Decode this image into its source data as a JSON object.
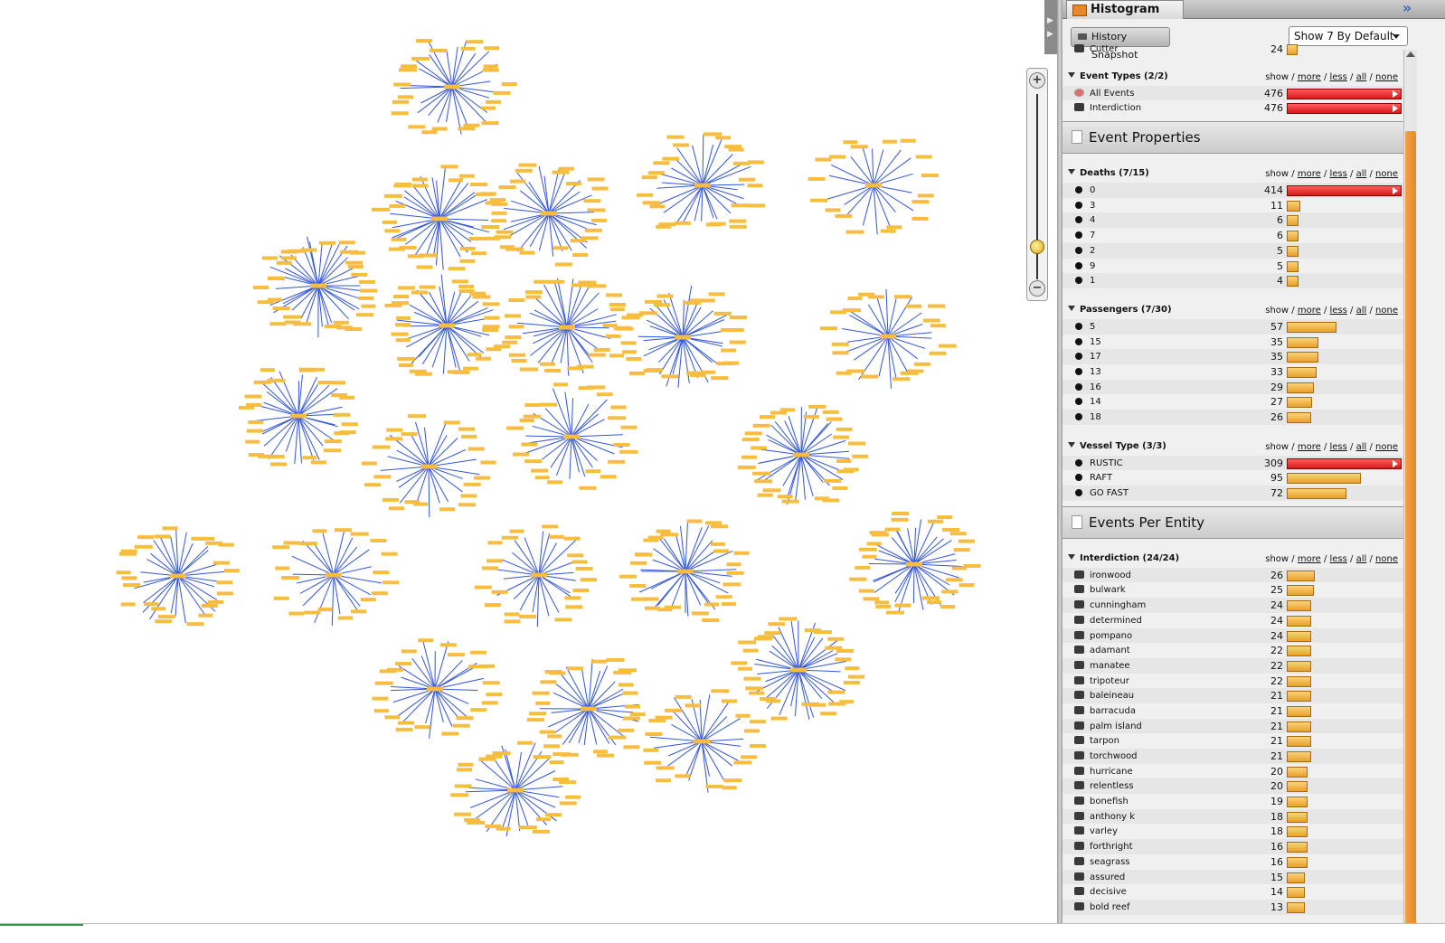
{
  "panel": {
    "title": "Histogram",
    "snapshot_label": "History Snapshot",
    "show_select": "Show 7 By Default"
  },
  "link_words": {
    "show": "show",
    "more": "more",
    "less": "less",
    "all": "all",
    "none": "none",
    "sep": "/"
  },
  "top_partial": {
    "label": "Cutter",
    "count": 24,
    "frac": 0.05
  },
  "event_types": {
    "title": "Event Types (2/2)",
    "rows": [
      {
        "label": "All Events",
        "count": 476,
        "frac": 1.0,
        "red": true,
        "icon": "globe-icon"
      },
      {
        "label": "Interdiction",
        "count": 476,
        "frac": 1.0,
        "red": true,
        "icon": "boat-icon"
      }
    ]
  },
  "sections": [
    {
      "title": "Event Properties",
      "groups": [
        {
          "title": "Deaths (7/15)",
          "rows": [
            {
              "label": "0",
              "count": 414,
              "frac": 1.0,
              "red": true
            },
            {
              "label": "3",
              "count": 11,
              "frac": 0.1
            },
            {
              "label": "4",
              "count": 6,
              "frac": 0.09
            },
            {
              "label": "7",
              "count": 6,
              "frac": 0.09
            },
            {
              "label": "2",
              "count": 5,
              "frac": 0.09
            },
            {
              "label": "9",
              "count": 5,
              "frac": 0.09
            },
            {
              "label": "1",
              "count": 4,
              "frac": 0.09
            }
          ]
        },
        {
          "title": "Passengers (7/30)",
          "rows": [
            {
              "label": "5",
              "count": 57,
              "frac": 0.42
            },
            {
              "label": "15",
              "count": 35,
              "frac": 0.26
            },
            {
              "label": "17",
              "count": 35,
              "frac": 0.26
            },
            {
              "label": "13",
              "count": 33,
              "frac": 0.25
            },
            {
              "label": "16",
              "count": 29,
              "frac": 0.22
            },
            {
              "label": "14",
              "count": 27,
              "frac": 0.21
            },
            {
              "label": "18",
              "count": 26,
              "frac": 0.2
            }
          ]
        },
        {
          "title": "Vessel Type (3/3)",
          "rows": [
            {
              "label": "RUSTIC",
              "count": 309,
              "frac": 1.0,
              "red": true
            },
            {
              "label": "RAFT",
              "count": 95,
              "frac": 0.64
            },
            {
              "label": "GO FAST",
              "count": 72,
              "frac": 0.51
            }
          ]
        }
      ]
    },
    {
      "title": "Events Per Entity",
      "groups": [
        {
          "title": "Interdiction (24/24)",
          "icon": "boat-icon",
          "rows": [
            {
              "label": "ironwood",
              "count": 26,
              "frac": 0.23
            },
            {
              "label": "bulwark",
              "count": 25,
              "frac": 0.22
            },
            {
              "label": "cunningham",
              "count": 24,
              "frac": 0.2
            },
            {
              "label": "determined",
              "count": 24,
              "frac": 0.2
            },
            {
              "label": "pompano",
              "count": 24,
              "frac": 0.2
            },
            {
              "label": "adamant",
              "count": 22,
              "frac": 0.2
            },
            {
              "label": "manatee",
              "count": 22,
              "frac": 0.2
            },
            {
              "label": "tripoteur",
              "count": 22,
              "frac": 0.2
            },
            {
              "label": "baleineau",
              "count": 21,
              "frac": 0.2
            },
            {
              "label": "barracuda",
              "count": 21,
              "frac": 0.2
            },
            {
              "label": "palm island",
              "count": 21,
              "frac": 0.2
            },
            {
              "label": "tarpon",
              "count": 21,
              "frac": 0.2
            },
            {
              "label": "torchwood",
              "count": 21,
              "frac": 0.2
            },
            {
              "label": "hurricane",
              "count": 20,
              "frac": 0.17
            },
            {
              "label": "relentless",
              "count": 20,
              "frac": 0.17
            },
            {
              "label": "bonefish",
              "count": 19,
              "frac": 0.17
            },
            {
              "label": "anthony k",
              "count": 18,
              "frac": 0.17
            },
            {
              "label": "varley",
              "count": 18,
              "frac": 0.17
            },
            {
              "label": "forthright",
              "count": 16,
              "frac": 0.17
            },
            {
              "label": "seagrass",
              "count": 16,
              "frac": 0.17
            },
            {
              "label": "assured",
              "count": 15,
              "frac": 0.14
            },
            {
              "label": "decisive",
              "count": 14,
              "frac": 0.14
            },
            {
              "label": "bold reef",
              "count": 13,
              "frac": 0.14
            }
          ]
        }
      ]
    }
  ],
  "graph": {
    "spoke_color": "#3355dd",
    "node_color": "#f7bd3e",
    "cluster_sizes": [
      24,
      26,
      18,
      30,
      26,
      32,
      30,
      28,
      30,
      22,
      28,
      24,
      30,
      22,
      26,
      20,
      22,
      28,
      30,
      24,
      26,
      30,
      22,
      24,
      28,
      22
    ],
    "zoom_level": 0.82
  },
  "colors": {
    "bar": "#f0b040",
    "bar_highlight": "#e02020",
    "scroll_thumb": "#e8902e"
  }
}
